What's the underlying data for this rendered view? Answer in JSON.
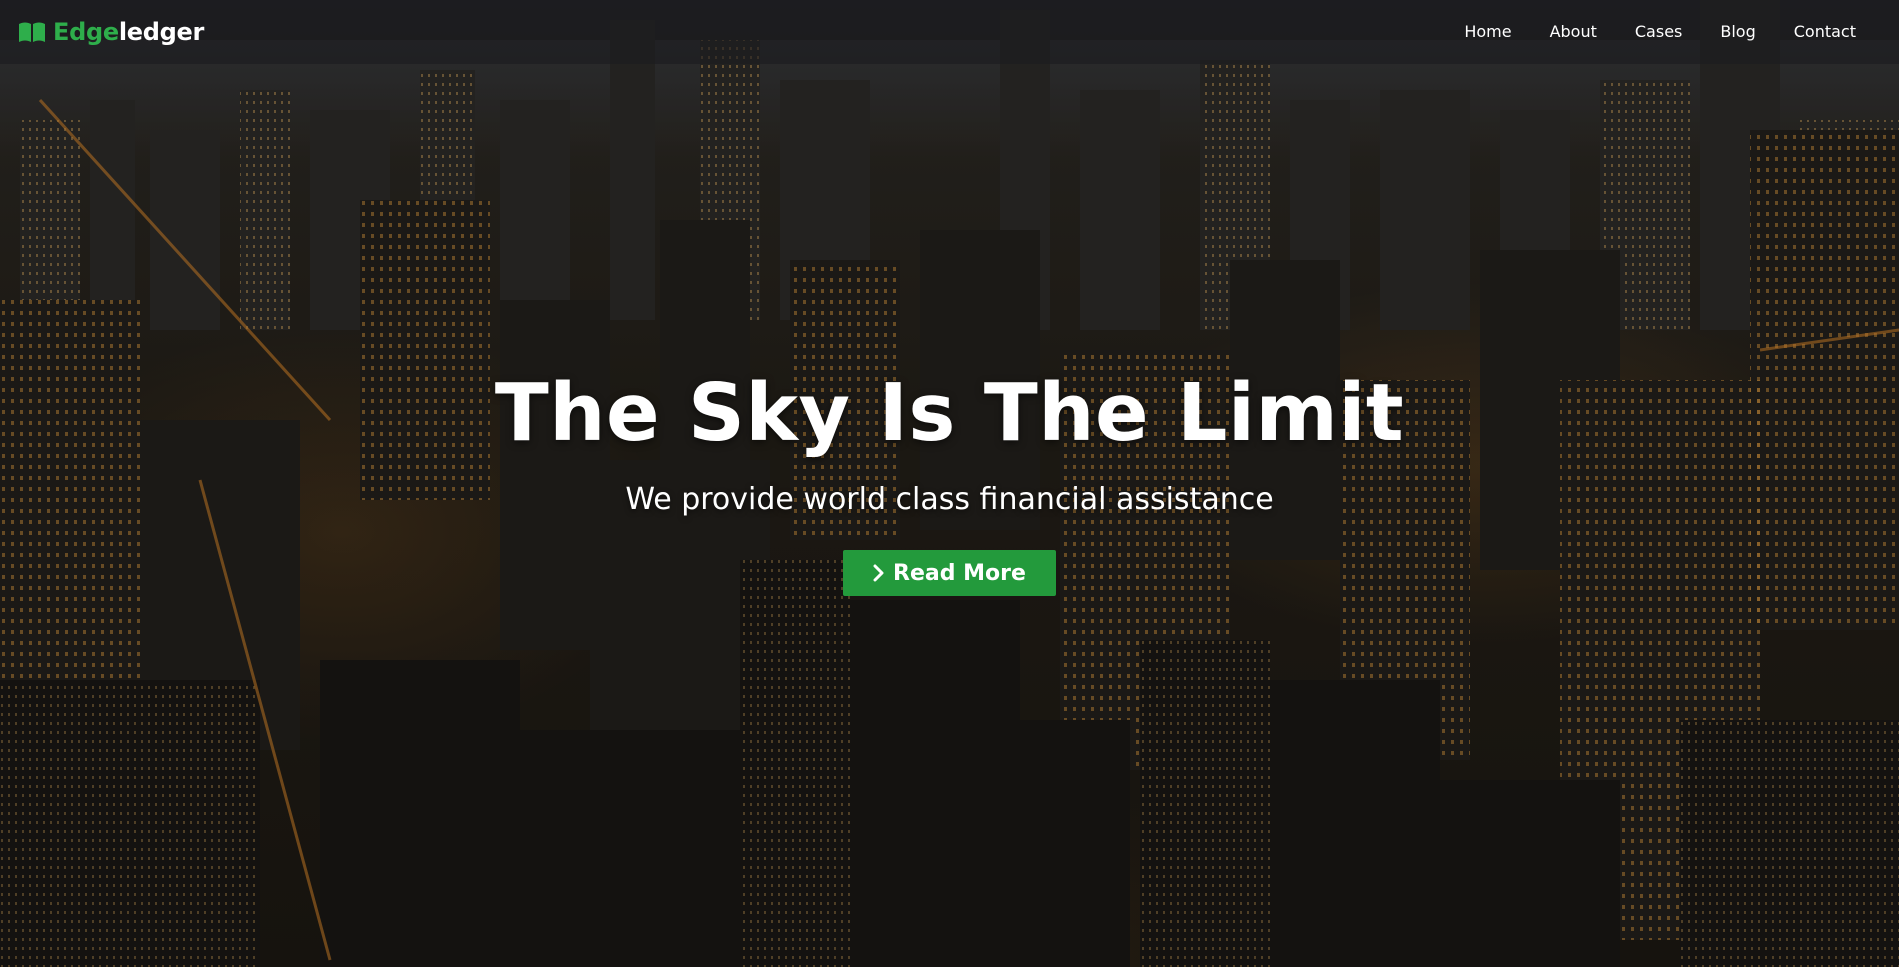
{
  "brand": {
    "name_part1": "Edge",
    "name_part2": "ledger",
    "icon": "open-book-icon",
    "accent_color": "#2eae4b"
  },
  "nav": {
    "items": [
      {
        "label": "Home"
      },
      {
        "label": "About"
      },
      {
        "label": "Cases"
      },
      {
        "label": "Blog"
      },
      {
        "label": "Contact"
      }
    ]
  },
  "hero": {
    "title": "The Sky Is The Limit",
    "subtitle": "We provide world class financial assistance",
    "cta_label": "Read More",
    "cta_icon": "chevron-right-icon",
    "cta_color": "#239a3c",
    "background": "night city skyline aerial photo"
  }
}
